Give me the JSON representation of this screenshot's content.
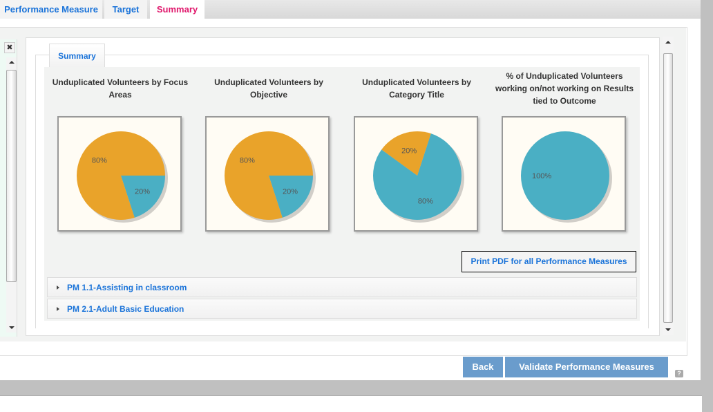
{
  "tabs": [
    {
      "label": "Performance Measure"
    },
    {
      "label": "Target"
    },
    {
      "label": "Summary",
      "active": true
    }
  ],
  "legend": "Summary",
  "charts": [
    {
      "title": "Unduplicated Volunteers by Focus Areas",
      "slices": [
        {
          "label": "20%",
          "value": 20,
          "color": "#4aafc4"
        },
        {
          "label": "80%",
          "value": 80,
          "color": "#e9a32a"
        }
      ],
      "start_angle_deg": 0
    },
    {
      "title": "Unduplicated Volunteers by Objective",
      "slices": [
        {
          "label": "20%",
          "value": 20,
          "color": "#4aafc4"
        },
        {
          "label": "80%",
          "value": 80,
          "color": "#e9a32a"
        }
      ],
      "start_angle_deg": 0
    },
    {
      "title": "Unduplicated Volunteers by Category Title",
      "slices": [
        {
          "label": "80%",
          "value": 80,
          "color": "#4aafc4"
        },
        {
          "label": "20%",
          "value": 20,
          "color": "#e9a32a"
        }
      ],
      "start_angle_deg": 0
    },
    {
      "title": "% of Unduplicated Volunteers working on/not working on Results tied to Outcome",
      "slices": [
        {
          "label": "100%",
          "value": 100,
          "color": "#4aafc4"
        }
      ],
      "start_angle_deg": 0
    }
  ],
  "print_button": "Print PDF for all Performance Measures",
  "accordion": [
    {
      "label": "PM 1.1-Assisting in classroom"
    },
    {
      "label": "PM 2.1-Adult Basic Education"
    }
  ],
  "buttons": {
    "back": "Back",
    "validate": "Validate Performance Measures",
    "help": "?",
    "close": "✖"
  },
  "colors": {
    "accent": "#1a73d9",
    "active_tab": "#e0186c",
    "button": "#6a9ccc",
    "orange": "#e9a32a",
    "teal": "#4aafc4"
  }
}
